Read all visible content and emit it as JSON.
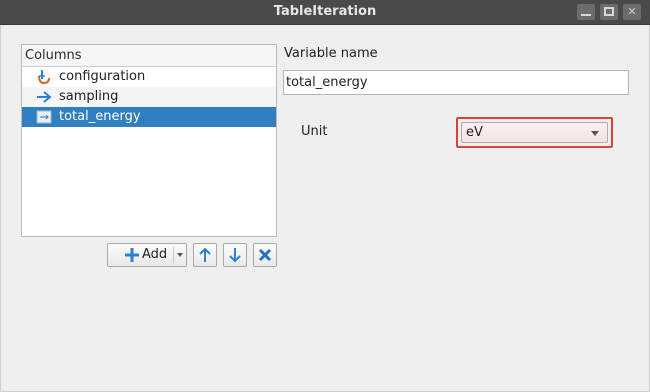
{
  "window": {
    "title": "TableIteration"
  },
  "columns": {
    "header": "Columns",
    "items": [
      {
        "label": "configuration",
        "icon": "configuration-icon"
      },
      {
        "label": "sampling",
        "icon": "arrow-right-icon"
      },
      {
        "label": "total_energy",
        "icon": "variable-icon",
        "selected": true
      }
    ]
  },
  "toolbar": {
    "add_label": "Add"
  },
  "form": {
    "variable_name_label": "Variable name",
    "variable_name_value": "total_energy",
    "unit_label": "Unit",
    "unit_value": "eV"
  },
  "colors": {
    "selection": "#2f7fc1",
    "highlight": "#e0403a",
    "accent_icon": "#2b7fd6",
    "delete_icon": "#2a6fc4"
  }
}
